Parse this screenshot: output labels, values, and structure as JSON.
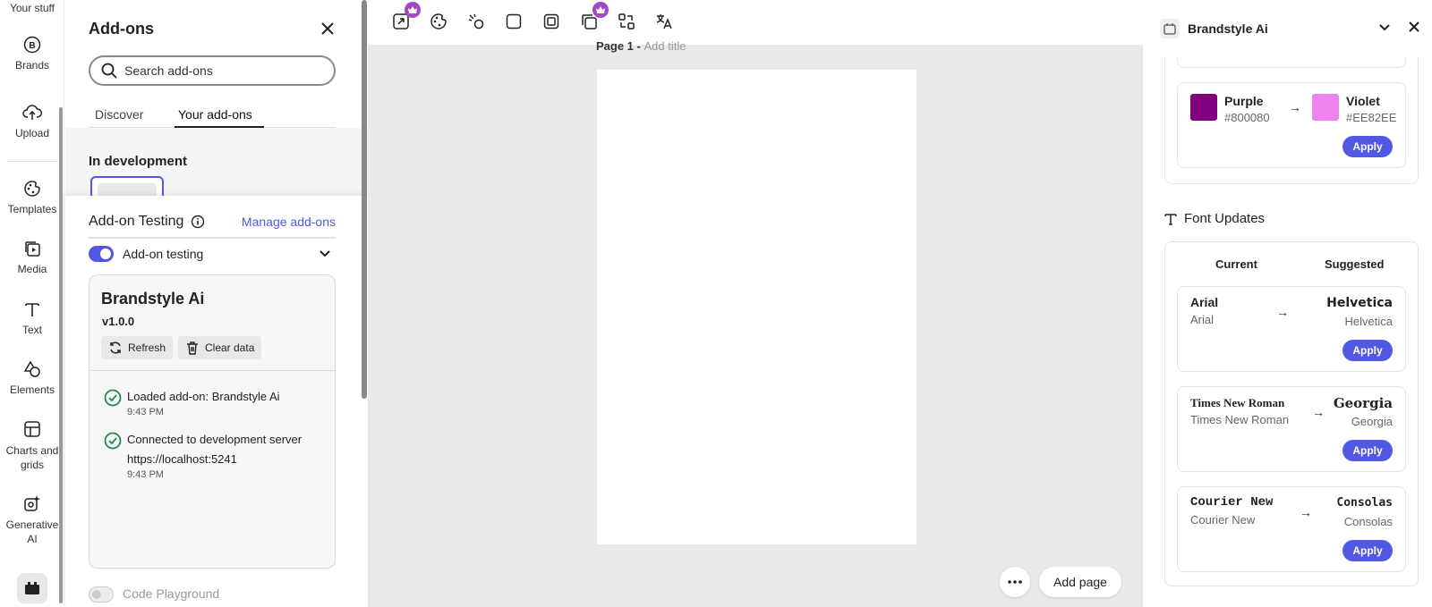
{
  "rail": {
    "top_label": "Your stuff",
    "items": [
      {
        "label": "Brands",
        "icon": "brands-icon"
      },
      {
        "label": "Upload",
        "icon": "upload-icon"
      },
      {
        "label": "Templates",
        "icon": "templates-icon"
      },
      {
        "label": "Media",
        "icon": "media-icon"
      },
      {
        "label": "Text",
        "icon": "text-icon"
      },
      {
        "label": "Elements",
        "icon": "elements-icon"
      },
      {
        "label": "Charts and grids",
        "icon": "charts-icon"
      },
      {
        "label": "Generative AI",
        "icon": "generative-ai-icon"
      }
    ]
  },
  "addons": {
    "title": "Add-ons",
    "search_placeholder": "Search add-ons",
    "tabs": [
      "Discover",
      "Your add-ons"
    ],
    "in_development": "In development",
    "testing": {
      "title": "Add-on Testing",
      "manage": "Manage add-ons",
      "toggle_label": "Add-on testing",
      "card": {
        "name": "Brandstyle Ai",
        "version": "v1.0.0",
        "refresh": "Refresh",
        "clear": "Clear data",
        "logs": [
          {
            "msg": "Loaded add-on: Brandstyle Ai",
            "time": "9:43 PM"
          },
          {
            "msg": "Connected to development server https://localhost:5241",
            "time": "9:43 PM"
          }
        ]
      },
      "playground": "Code Playground"
    }
  },
  "canvas": {
    "page_label": "Page 1 - ",
    "page_placeholder": "Add title",
    "add_page": "Add page"
  },
  "brandstyle": {
    "title": "Brandstyle Ai",
    "color_pair": {
      "current_name": "Purple",
      "current_hex": "#800080",
      "suggested_name": "Violet",
      "suggested_hex": "#EE82EE",
      "apply": "Apply"
    },
    "font_updates": {
      "title": "Font Updates",
      "col_current": "Current",
      "col_suggested": "Suggested",
      "rows": [
        {
          "current": "Arial",
          "current_sub": "Arial",
          "suggested": "Helvetica",
          "suggested_sub": "Helvetica",
          "apply": "Apply"
        },
        {
          "current": "Times New Roman",
          "current_sub": "Times New Roman",
          "suggested": "Georgia",
          "suggested_sub": "Georgia",
          "apply": "Apply"
        },
        {
          "current": "Courier New",
          "current_sub": "Courier New",
          "suggested": "Consolas",
          "suggested_sub": "Consolas",
          "apply": "Apply"
        }
      ]
    }
  },
  "colors": {
    "accent": "#5258e4",
    "premium": "#a347c4",
    "success": "#1e8a4c"
  }
}
